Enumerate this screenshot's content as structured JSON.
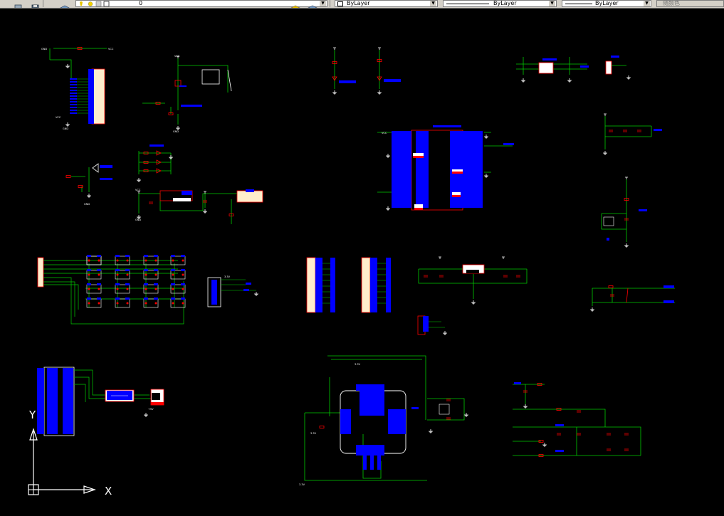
{
  "toolbar": {
    "layer_value": "0",
    "color_value": "ByLayer",
    "linetype_value": "ByLayer",
    "lineweight_value": "ByLayer",
    "plotstyle_value": "随颜色"
  },
  "ucs": {
    "x_label": "X",
    "y_label": "Y"
  },
  "schematic_labels": {
    "gnd": "GND",
    "vcc": "VCC",
    "v33": "3.3V",
    "v5": "+5V"
  },
  "colors": {
    "background": "#000000",
    "wire": "#00c000",
    "pin": "#0000ff",
    "part": "#ff0000",
    "body": "#ffeecc",
    "text": "#ffffff"
  }
}
